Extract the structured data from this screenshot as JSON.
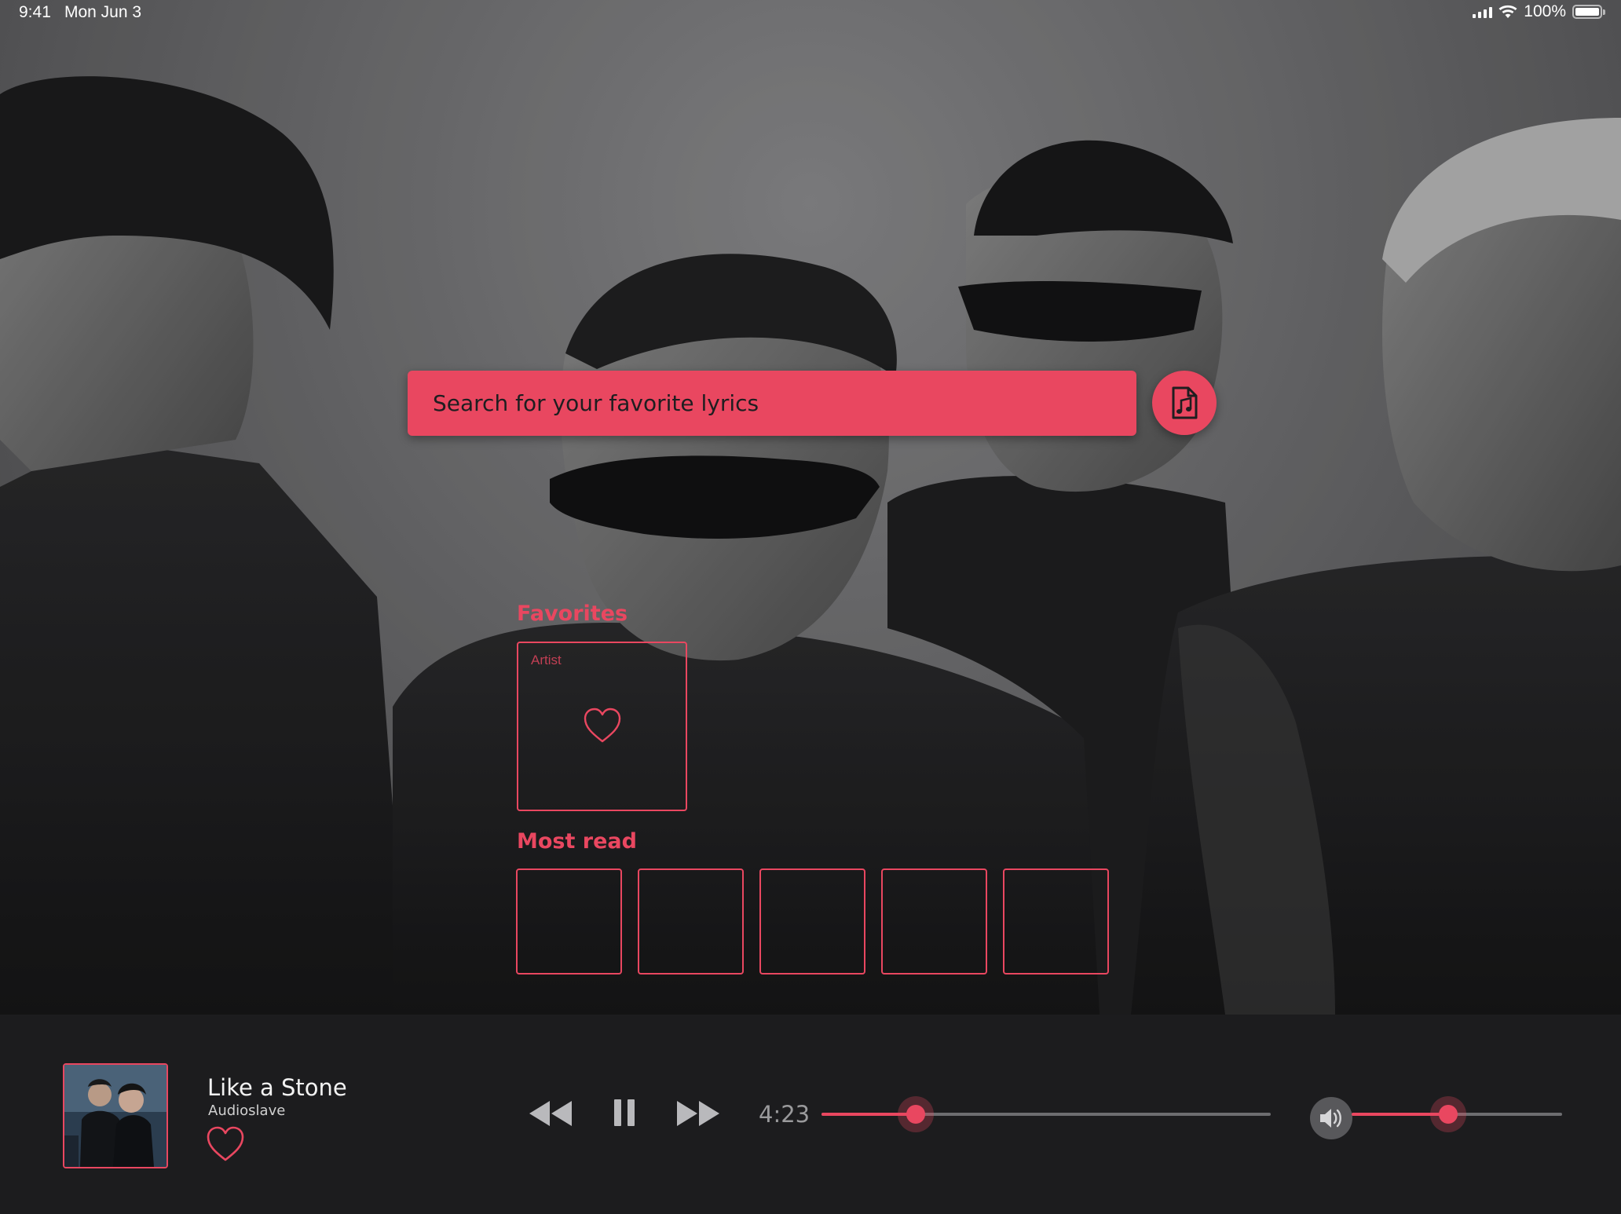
{
  "status_bar": {
    "time": "9:41",
    "date": "Mon Jun 3",
    "battery": "100%"
  },
  "search": {
    "placeholder": "Search for your favorite lyrics",
    "button_icon": "music-file-icon"
  },
  "favorites": {
    "title": "Favorites",
    "cards": [
      {
        "label": "Artist",
        "icon": "heart-icon"
      }
    ]
  },
  "most_read": {
    "title": "Most read",
    "card_count": 5
  },
  "player": {
    "track_title": "Like a Stone",
    "artist": "Audioslave",
    "elapsed": "4:23",
    "progress": 0.21,
    "volume": 0.46,
    "controls": [
      "rewind-icon",
      "pause-icon",
      "fast-forward-icon"
    ]
  },
  "colors": {
    "accent": "#e94760",
    "player_background": "#1c1c1e",
    "track": "#6d6d70"
  }
}
